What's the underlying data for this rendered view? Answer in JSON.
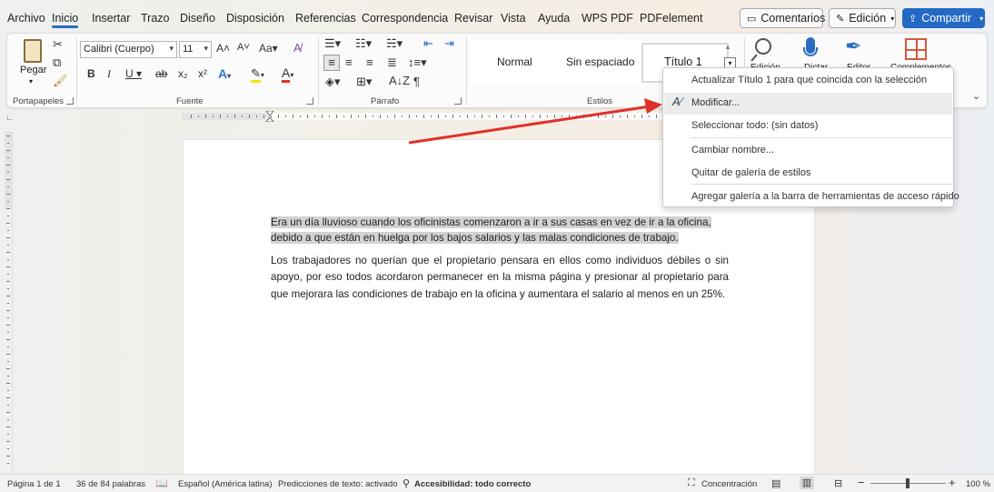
{
  "menu": {
    "tabs": [
      "Archivo",
      "Inicio",
      "Insertar",
      "Trazo",
      "Diseño",
      "Disposición",
      "Referencias",
      "Correspondencia",
      "Revisar",
      "Vista",
      "Ayuda",
      "WPS PDF",
      "PDFelement"
    ],
    "active_tab": "Inicio",
    "comments_label": "Comentarios",
    "editing_label": "Edición",
    "share_label": "Compartir"
  },
  "ribbon": {
    "clipboard": {
      "paste_label": "Pegar",
      "group_label": "Portapapeles"
    },
    "font": {
      "font_name": "Calibri (Cuerpo)",
      "font_size": "11",
      "group_label": "Fuente"
    },
    "paragraph": {
      "group_label": "Párrafo"
    },
    "styles": {
      "items": [
        "Normal",
        "Sin espaciado",
        "Título 1"
      ],
      "group_label": "Estilos"
    },
    "right_partial_labels": [
      "Edición",
      "Dictar",
      "Editor",
      "Complementos"
    ]
  },
  "context_menu": {
    "items": [
      "Actualizar Título 1 para que coincida con la selección",
      "Modificar...",
      "Seleccionar todo: (sin datos)",
      "Cambiar nombre...",
      "Quitar de galería de estilos",
      "Agregar galería a la barra de herramientas de acceso rápido"
    ],
    "highlighted_index": 1
  },
  "document": {
    "paragraph1_line1": "Era un día lluvioso cuando los oficinistas comenzaron a ir a sus casas en vez de ir a la oficina,",
    "paragraph1_line2": "debido a que están en huelga por los bajos salarios y las malas condiciones de trabajo.",
    "paragraph2": "Los trabajadores no querían que el propietario pensara en ellos como individuos débiles o sin apoyo, por eso todos acordaron permanecer en la misma página y presionar al propietario para que mejorara las condiciones de trabajo en la oficina y aumentara el salario al menos en un 25%."
  },
  "status_bar": {
    "page": "Página 1 de 1",
    "words": "36 de 84 palabras",
    "language": "Español (América latina)",
    "predictions": "Predicciones de texto: activado",
    "accessibility": "Accesibilidad: todo correcto",
    "focus": "Concentración",
    "zoom": "100 %"
  },
  "colors": {
    "accent": "#2469c4",
    "arrow": "#e0302a",
    "selection": "#d2d2d2"
  }
}
